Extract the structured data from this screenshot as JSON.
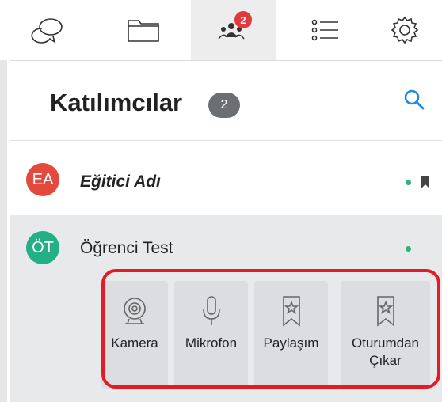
{
  "nav": {
    "tabs": [
      {
        "name": "chat-icon"
      },
      {
        "name": "folder-icon"
      },
      {
        "name": "participants-icon",
        "badge": "2",
        "active": true
      },
      {
        "name": "list-icon"
      },
      {
        "name": "settings-icon"
      }
    ],
    "badge_color": "#e0393e"
  },
  "header": {
    "title": "Katılımcılar",
    "count": "2",
    "search_icon": "search-icon",
    "accent": "#1e88e5"
  },
  "participants": [
    {
      "initials": "EA",
      "name": "Eğitici Adı",
      "avatar_color": "#e34a3d",
      "online": true,
      "bookmark_icon": "bookmark-icon"
    },
    {
      "initials": "ÖT",
      "name": "Öğrenci Test",
      "avatar_color": "#23b085",
      "online": true
    }
  ],
  "actions": [
    {
      "label": "Kamera",
      "icon": "camera-icon"
    },
    {
      "label": "Mikrofon",
      "icon": "microphone-icon"
    },
    {
      "label": "Paylaşım",
      "icon": "star-bookmark-icon"
    },
    {
      "label": "Oturumdan\nÇıkar",
      "icon": "star-bookmark-icon"
    }
  ],
  "online_color": "#2bb673",
  "highlight_color": "#e31b23"
}
